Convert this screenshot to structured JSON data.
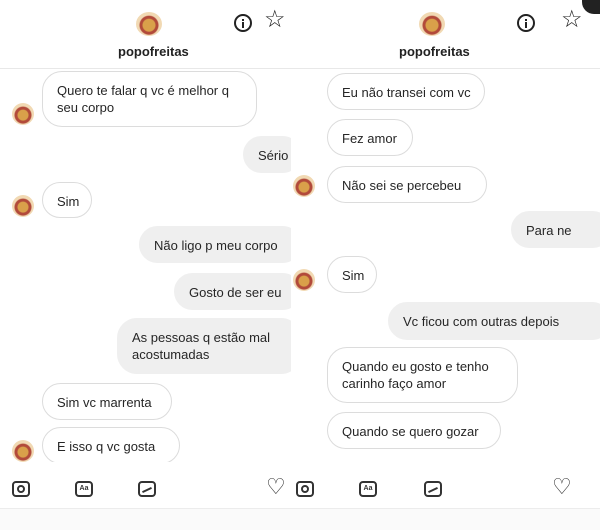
{
  "left": {
    "username": "popofreitas",
    "messages": [
      {
        "text": "Quero te falar q vc é melhor q\nseu corpo",
        "dir": "received"
      },
      {
        "text": "Sério",
        "dir": "sent"
      },
      {
        "text": "Sim",
        "dir": "received"
      },
      {
        "text": "Não ligo p meu corpo",
        "dir": "sent"
      },
      {
        "text": "Gosto de ser eu",
        "dir": "sent"
      },
      {
        "text": "As pessoas q estão mal\nacostumadas",
        "dir": "sent"
      },
      {
        "text": "Sim vc marrenta",
        "dir": "received"
      },
      {
        "text": "E isso q vc gosta",
        "dir": "received"
      }
    ]
  },
  "right": {
    "username": "popofreitas",
    "messages": [
      {
        "text": "Eu não transei com vc",
        "dir": "received"
      },
      {
        "text": "Fez amor",
        "dir": "received"
      },
      {
        "text": "Não sei se percebeu",
        "dir": "received"
      },
      {
        "text": "Para ne",
        "dir": "sent"
      },
      {
        "text": "Sim",
        "dir": "received"
      },
      {
        "text": "Vc ficou com outras depois",
        "dir": "sent"
      },
      {
        "text": "Quando eu gosto e tenho\ncarinho faço amor",
        "dir": "received"
      },
      {
        "text": "Quando se quero gozar",
        "dir": "received"
      }
    ]
  },
  "icons": {
    "info": "info-icon",
    "star": "star-icon",
    "camera": "camera-icon",
    "sticker": "sticker-icon",
    "sticker_label": "Aa",
    "gallery": "gallery-icon",
    "heart": "heart-icon"
  }
}
